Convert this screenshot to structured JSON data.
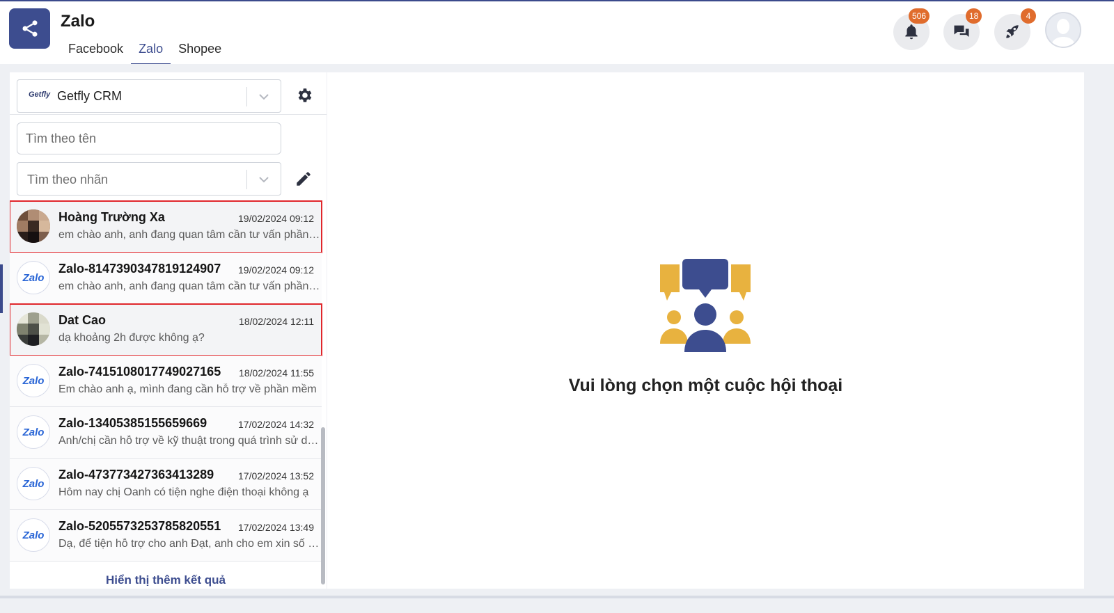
{
  "app": {
    "title": "Zalo",
    "tabs": [
      {
        "label": "Facebook",
        "active": false
      },
      {
        "label": "Zalo",
        "active": true
      },
      {
        "label": "Shopee",
        "active": false
      }
    ]
  },
  "header_actions": {
    "notifications_badge": "506",
    "messages_badge": "18",
    "rocket_badge": "4",
    "icons": [
      "bell-icon",
      "chat-icon",
      "rocket-icon",
      "user-avatar"
    ]
  },
  "sidebar": {
    "account_select": {
      "logo_text": "Getfly",
      "value": "Getfly CRM"
    },
    "search_name_placeholder": "Tìm theo tên",
    "search_label_placeholder": "Tìm theo nhãn",
    "conversations": [
      {
        "name": "Hoàng Trường Xa",
        "time": "19/02/2024 09:12",
        "preview": "em chào anh, anh đang quan tâm cần tư vấn phần mềm",
        "avatar": "photo",
        "highlighted": true
      },
      {
        "name": "Zalo-8147390347819124907",
        "time": "19/02/2024 09:12",
        "preview": "em chào anh, anh đang quan tâm cần tư vấn phần mềm",
        "avatar": "zalo",
        "avatar_text": "Zalo",
        "highlighted": false
      },
      {
        "name": "Dat Cao",
        "time": "18/02/2024 12:11",
        "preview": "dạ khoảng 2h được không ạ?",
        "avatar": "photo",
        "highlighted": true
      },
      {
        "name": "Zalo-7415108017749027165",
        "time": "18/02/2024 11:55",
        "preview": "Em chào anh ạ, mình đang cần hỗ trợ về phần mềm",
        "avatar": "zalo",
        "avatar_text": "Zalo",
        "highlighted": false
      },
      {
        "name": "Zalo-1340538515565​9669",
        "time": "17/02/2024 14:32",
        "preview": "Anh/chị cần hỗ trợ về kỹ thuật trong quá trình sử dụng",
        "avatar": "zalo",
        "avatar_text": "Zalo",
        "highlighted": false
      },
      {
        "name": "Zalo-473773427363413289",
        "time": "17/02/2024 13:52",
        "preview": "Hôm nay chị Oanh có tiện nghe điện thoại không ạ",
        "avatar": "zalo",
        "avatar_text": "Zalo",
        "highlighted": false
      },
      {
        "name": "Zalo-5205573253785820551",
        "time": "17/02/2024 13:49",
        "preview": "Dạ, để tiện hỗ trợ cho anh Đạt, anh cho em xin số điện thoại",
        "avatar": "zalo",
        "avatar_text": "Zalo",
        "highlighted": false
      }
    ],
    "show_more": "Hiển thị thêm kết quả"
  },
  "main": {
    "empty_state_text": "Vui lòng chọn một cuộc hội thoại"
  },
  "colors": {
    "brand": "#3d4d8f",
    "badge": "#e06c2d",
    "highlight_border": "#e0262b",
    "illustration_gold": "#e8b23f"
  }
}
